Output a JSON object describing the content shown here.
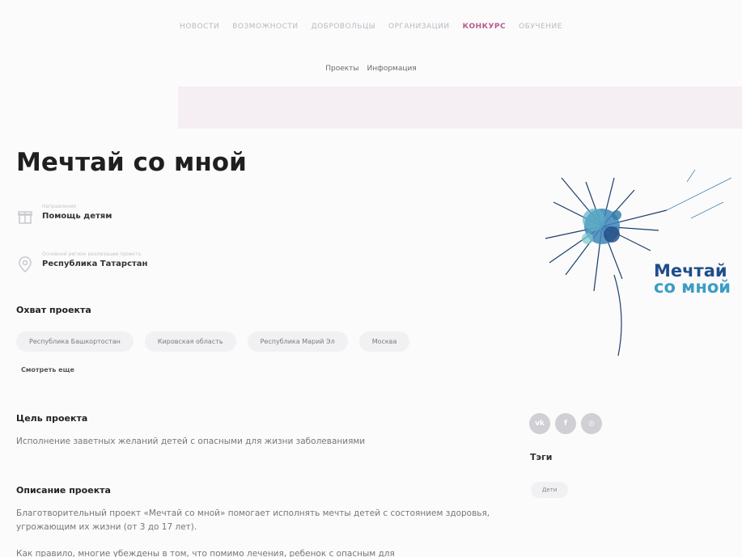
{
  "nav": {
    "items": [
      {
        "label": "НОВОСТИ",
        "active": false
      },
      {
        "label": "ВОЗМОЖНОСТИ",
        "active": false
      },
      {
        "label": "ДОБРОВОЛЬЦЫ",
        "active": false
      },
      {
        "label": "ОРГАНИЗАЦИИ",
        "active": false
      },
      {
        "label": "КОНКУРС",
        "active": true
      },
      {
        "label": "ОБУЧЕНИЕ",
        "active": false
      }
    ]
  },
  "subtabs": {
    "projects": "Проекты",
    "info": "Информация"
  },
  "project": {
    "title": "Мечтай со мной",
    "direction_caption": "Направление",
    "direction_value": "Помощь детям",
    "region_caption": "Основной регион реализации проекта",
    "region_value": "Республика Татарстан"
  },
  "coverage": {
    "heading": "Охват проекта",
    "regions": [
      "Республика Башкортостан",
      "Кировская область",
      "Республика Марий Эл",
      "Москва"
    ],
    "more_label": "Смотреть еще"
  },
  "goal": {
    "heading": "Цель проекта",
    "text": "Исполнение заветных желаний детей с опасными для жизни заболеваниями"
  },
  "description": {
    "heading": "Описание проекта",
    "paragraph1": "Благотворительный проект «Мечтай со мной» помогает исполнять мечты детей с состоянием здоровья, угрожающим их жизни (от 3 до 17 лет).",
    "paragraph2": "Как правило, многие убеждены в том, что помимо лечения, ребенок с опасным для"
  },
  "logo": {
    "line1": "Мечтай",
    "line2": "со мной",
    "brand_color": "#1f4e8a"
  },
  "social": {
    "icons": [
      "vk-icon",
      "facebook-icon",
      "instagram-icon"
    ]
  },
  "tags": {
    "heading": "Тэги",
    "items": [
      "Дети"
    ]
  },
  "colors": {
    "accent": "#b85a8d",
    "hero_strip": "#f5eef3"
  }
}
